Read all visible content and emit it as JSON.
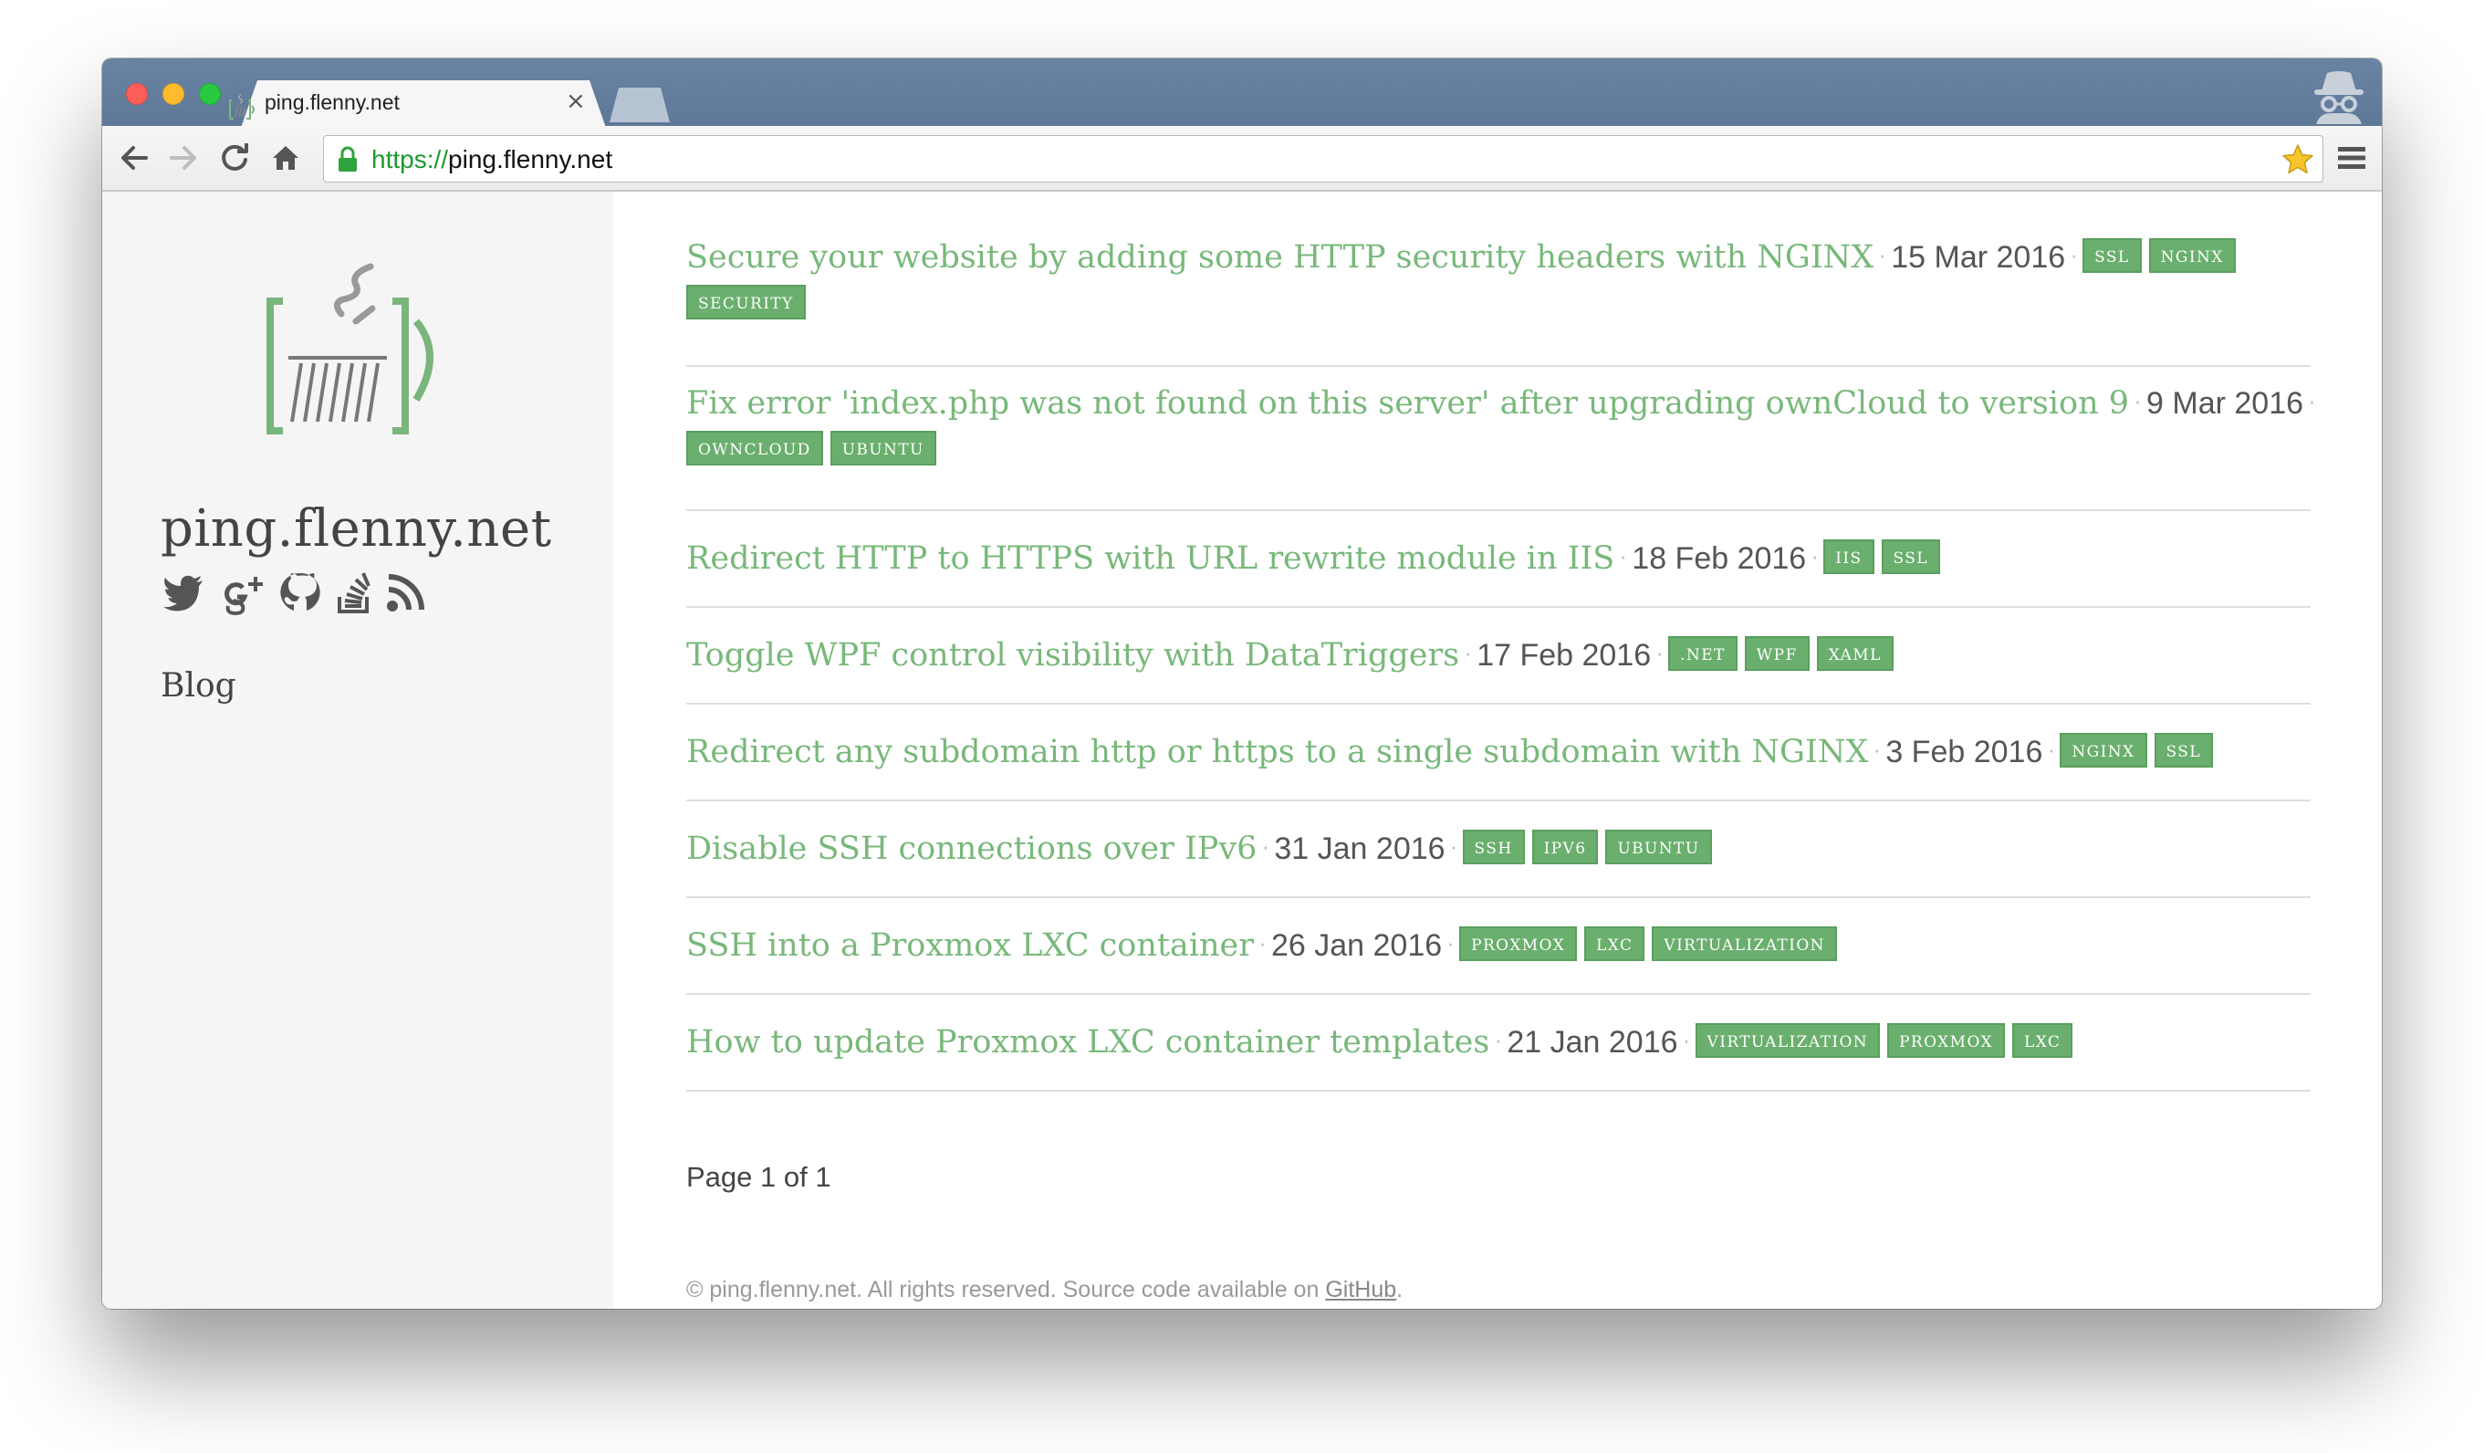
{
  "browser": {
    "tab_title": "ping.flenny.net",
    "tab_close": "×",
    "url_scheme": "https://",
    "url_host": "ping.flenny.net",
    "icons": [
      "back-arrow-icon",
      "forward-arrow-icon",
      "reload-icon",
      "home-icon",
      "lock-icon",
      "bookmark-star-icon",
      "menu-icon",
      "incognito-icon"
    ]
  },
  "sidebar": {
    "site_title": "ping.flenny.net",
    "social_icons": [
      "twitter-icon",
      "google-plus-icon",
      "github-icon",
      "stackoverflow-icon",
      "rss-icon"
    ],
    "nav": [
      {
        "label": "Blog"
      }
    ]
  },
  "posts": [
    {
      "title": "Secure your website by adding some HTTP security headers with NGINX",
      "date": "15 Mar 2016",
      "tags": [
        "SSL",
        "NGINX",
        "SECURITY"
      ]
    },
    {
      "title": "Fix error 'index.php was not found on this server' after upgrading ownCloud to version 9",
      "date": "9 Mar 2016",
      "tags": [
        "OWNCLOUD",
        "UBUNTU"
      ]
    },
    {
      "title": "Redirect HTTP to HTTPS with URL rewrite module in IIS",
      "date": "18 Feb 2016",
      "tags": [
        "IIS",
        "SSL"
      ]
    },
    {
      "title": "Toggle WPF control visibility with DataTriggers",
      "date": "17 Feb 2016",
      "tags": [
        ".NET",
        "WPF",
        "XAML"
      ]
    },
    {
      "title": "Redirect any subdomain http or https to a single subdomain with NGINX",
      "date": "3 Feb 2016",
      "tags": [
        "NGINX",
        "SSL"
      ]
    },
    {
      "title": "Disable SSH connections over IPv6",
      "date": "31 Jan 2016",
      "tags": [
        "SSH",
        "IPV6",
        "UBUNTU"
      ]
    },
    {
      "title": "SSH into a Proxmox LXC container",
      "date": "26 Jan 2016",
      "tags": [
        "PROXMOX",
        "LXC",
        "VIRTUALIZATION"
      ]
    },
    {
      "title": "How to update Proxmox LXC container templates",
      "date": "21 Jan 2016",
      "tags": [
        "VIRTUALIZATION",
        "PROXMOX",
        "LXC"
      ]
    }
  ],
  "pagination": "Page 1 of 1",
  "footer": {
    "text": "© ping.flenny.net. All rights reserved. Source code available on ",
    "link_label": "GitHub",
    "end": "."
  },
  "colors": {
    "accent": "#78b87a",
    "tag_bg": "#6aaf6d",
    "titlebar": "#5e7898"
  }
}
